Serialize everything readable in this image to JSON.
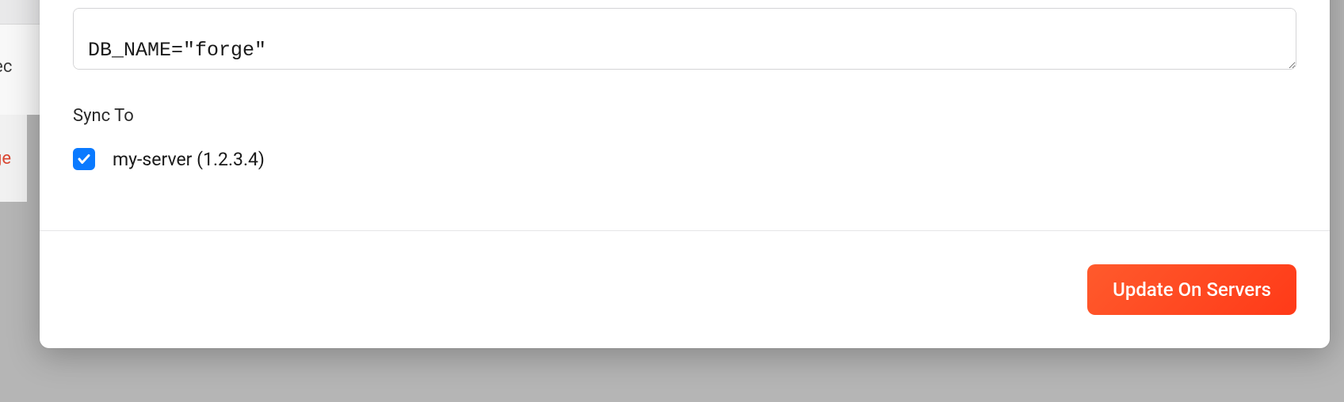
{
  "backdrop": {
    "text1": "nec",
    "text2": "ge"
  },
  "env": {
    "content": "DB_NAME=\"forge\""
  },
  "sync": {
    "label": "Sync To",
    "items": [
      {
        "label": "my-server (1.2.3.4)",
        "checked": true
      }
    ]
  },
  "actions": {
    "update_label": "Update On Servers"
  }
}
